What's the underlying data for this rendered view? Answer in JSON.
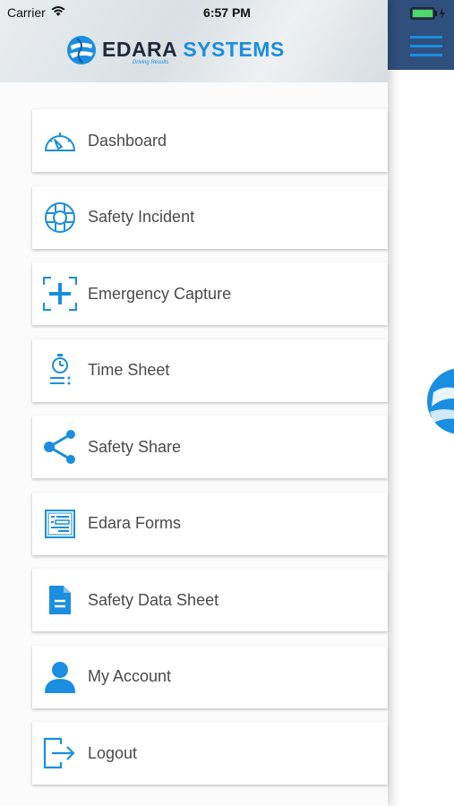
{
  "status": {
    "carrier": "Carrier",
    "time": "6:57 PM"
  },
  "brand": {
    "name_part1": "EDARA",
    "name_part2": "SYSTEMS",
    "tagline": "Driving Results"
  },
  "menu": [
    {
      "label": "Dashboard",
      "icon": "dashboard-gauge-icon"
    },
    {
      "label": "Safety Incident",
      "icon": "lifebuoy-icon"
    },
    {
      "label": "Emergency Capture",
      "icon": "emergency-capture-icon"
    },
    {
      "label": "Time Sheet",
      "icon": "stopwatch-icon"
    },
    {
      "label": "Safety Share",
      "icon": "share-icon"
    },
    {
      "label": "Edara Forms",
      "icon": "form-icon"
    },
    {
      "label": "Safety Data Sheet",
      "icon": "document-icon"
    },
    {
      "label": "My Account",
      "icon": "user-icon"
    },
    {
      "label": "Logout",
      "icon": "logout-icon"
    }
  ],
  "colors": {
    "accent": "#1a8ee0",
    "appbar": "#2f4f7d",
    "text": "#4a4a4a"
  }
}
